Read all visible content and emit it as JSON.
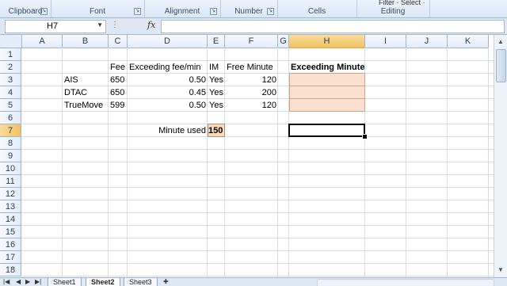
{
  "ribbon": {
    "groups": [
      {
        "label": "Clipboard"
      },
      {
        "label": "Font"
      },
      {
        "label": "Alignment"
      },
      {
        "label": "Number"
      },
      {
        "label": "Cells"
      },
      {
        "label": "Editing"
      }
    ],
    "editing_cut_text": "Filter · Select ·"
  },
  "formula_bar": {
    "name_box": "H7",
    "fx_label": "fx",
    "formula": ""
  },
  "columns": [
    "A",
    "B",
    "C",
    "D",
    "E",
    "F",
    "G",
    "H",
    "I",
    "J",
    "K"
  ],
  "selected_column": "H",
  "rows": [
    "1",
    "2",
    "3",
    "4",
    "5",
    "6",
    "7",
    "8",
    "9",
    "10",
    "11",
    "12",
    "13",
    "14",
    "15",
    "16",
    "17",
    "18"
  ],
  "selected_row": "7",
  "cells": {
    "C2": "Fee",
    "D2": "Exceeding fee/min",
    "E2": "IM",
    "F2": "Free Minute",
    "H2": "Exceeding Minute",
    "B3": "AIS",
    "C3": "650",
    "D3": "0.50",
    "E3": "Yes",
    "F3": "120",
    "B4": "DTAC",
    "C4": "650",
    "D4": "0.45",
    "E4": "Yes",
    "F4": "200",
    "B5": "TrueMove",
    "C5": "599",
    "D5": "0.50",
    "E5": "Yes",
    "F5": "120",
    "D7": "Minute used",
    "E7": "150"
  },
  "sheet_tabs": [
    {
      "label": "Sheet1",
      "active": false
    },
    {
      "label": "Sheet2",
      "active": true
    },
    {
      "label": "Sheet3",
      "active": false
    }
  ],
  "colors": {
    "exceeding_fill": "#fbe0cf",
    "minute_input_fill": "#fcd9b0",
    "selected_header": "#f3c064"
  }
}
